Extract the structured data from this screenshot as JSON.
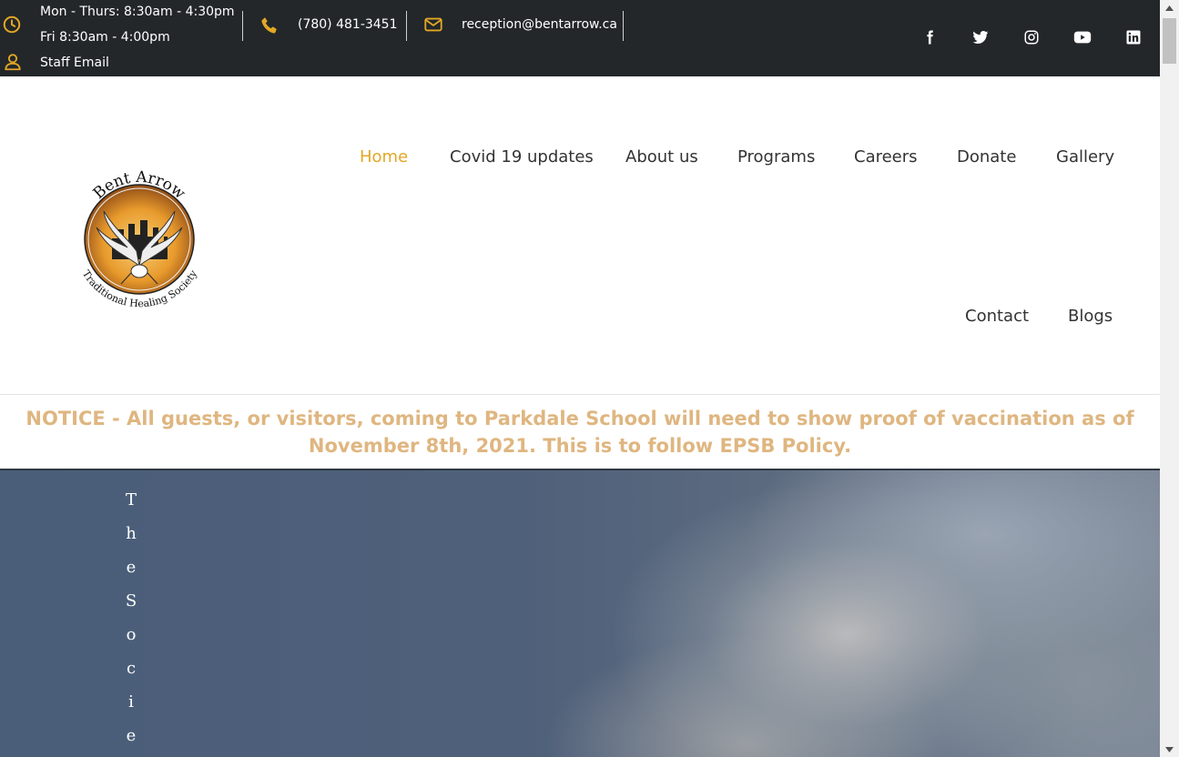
{
  "topbar": {
    "hours_line1": "Mon - Thurs: 8:30am - 4:30pm",
    "hours_line2": "Fri 8:30am - 4:00pm",
    "staff_email": "Staff Email",
    "phone": "(780) 481-3451",
    "email": "reception@bentarrow.ca",
    "accent_color": "#e3a726",
    "social": [
      "facebook-icon",
      "twitter-icon",
      "instagram-icon",
      "youtube-icon",
      "linkedin-icon"
    ]
  },
  "logo": {
    "top_text": "Bent Arrow",
    "bottom_text": "Traditional Healing Society"
  },
  "nav": {
    "items": [
      {
        "label": "Home",
        "active": true
      },
      {
        "label": "Covid 19 updates"
      },
      {
        "label": "About us"
      },
      {
        "label": "Programs"
      },
      {
        "label": "Careers"
      },
      {
        "label": "Donate"
      },
      {
        "label": "Gallery"
      },
      {
        "label": "Contact"
      },
      {
        "label": "Blogs"
      }
    ]
  },
  "notice": {
    "text": "NOTICE - All guests, or visitors, coming to Parkdale School will need to show proof of vaccination as of November 8th, 2021. This is to follow EPSB Policy.",
    "color": "#dfb680"
  },
  "hero": {
    "vertical_letters": [
      "T",
      "h",
      "e",
      "S",
      "o",
      "c",
      "i",
      "e"
    ]
  }
}
